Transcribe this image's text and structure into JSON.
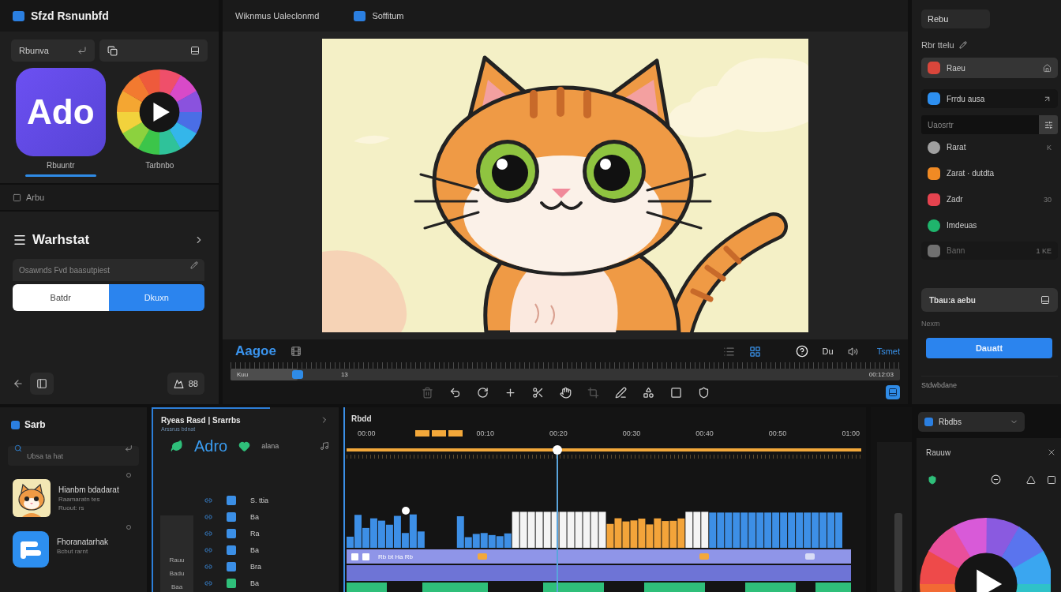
{
  "app_bar": {
    "title": "Sfzd Rsnunbfd"
  },
  "quick_buttons": [
    {
      "kind": "text",
      "label": "Rbunva"
    },
    {
      "kind": "icon"
    }
  ],
  "apps": [
    {
      "kind": "logo",
      "logo_text": "Ado",
      "label": "Rbuuntr",
      "selected": true
    },
    {
      "kind": "wheel",
      "label": "Tarbnbo",
      "selected": false
    }
  ],
  "section": {
    "label": "Arbu"
  },
  "workspace": {
    "title": "Warhstat",
    "field": {
      "placeholder": "Osawnds Fvd baasutpiest"
    },
    "segments": [
      {
        "label": "Batdr",
        "selected": false
      },
      {
        "label": "Dkuxn",
        "selected": true
      }
    ],
    "footer_button": "88"
  },
  "viewer": {
    "title": "Wiknmus Ualeclonmd",
    "tab": "Soffitum"
  },
  "player": {
    "title": "Aagoe",
    "speed": "Du",
    "mode": "Tsmet",
    "start": "Kuu",
    "mark": "13",
    "duration": "00:12:03",
    "level": 0.1
  },
  "inspector": {
    "tab": "Rebu",
    "heading": "Rbr ttelu",
    "pinned": [
      {
        "label": "Raeu",
        "color": "#d9463b",
        "selected": true
      },
      {
        "label": "Frrdu ausa",
        "color": "#2d8ff0",
        "selected": false
      }
    ],
    "field": {
      "placeholder": "Uaosrtr"
    },
    "items": [
      {
        "label": "Rarat",
        "color": "#a0a0a0",
        "meta": "K",
        "selected": false,
        "disabled": false
      },
      {
        "label": "Zarat · dutdta",
        "color": "#f08a24",
        "selected": false,
        "disabled": false
      },
      {
        "label": "Zadr",
        "color": "#e5434f",
        "meta": "30",
        "selected": false,
        "disabled": false
      },
      {
        "label": "Imdeuas",
        "color": "#1fb46c",
        "selected": false,
        "disabled": false
      },
      {
        "label": "Bann",
        "color": "#707070",
        "meta": "1 KE",
        "selected": false,
        "disabled": true
      }
    ],
    "section_button": "Tbau:a aebu",
    "note": "Nexm",
    "primary_button": "Dauatt",
    "footer": "Stdwbdane"
  },
  "media": {
    "title": "Sarb",
    "search": {
      "placeholder": "Ubsa ta hat"
    },
    "items": [
      {
        "kind": "cat",
        "title": "Hianbm bdadarat",
        "lines": [
          "Raamaratn tes",
          "Ruout: rs"
        ]
      },
      {
        "kind": "app",
        "title": "Fhoranatarhak",
        "lines": [
          "Bcbut rarnt"
        ]
      }
    ]
  },
  "tracks_panel": {
    "title": "Ryeas Rasd | Srarrbs",
    "subtitle": "Arssrus bdnat",
    "app_label": "Adro",
    "tag": "alana",
    "groups": [
      "Rauu",
      "Badu",
      "Baa"
    ],
    "tracks": [
      {
        "label": "S. ttia",
        "color": "#3b8fe6"
      },
      {
        "label": "Ba",
        "color": "#3b8fe6"
      },
      {
        "label": "Ra",
        "color": "#3b8fe6"
      },
      {
        "label": "Ba",
        "color": "#3b8fe6"
      },
      {
        "label": "Bra",
        "color": "#3b8fe6"
      },
      {
        "label": "Ba",
        "color": "#2fbf7a"
      }
    ]
  },
  "timeline": {
    "title": "Rbdd",
    "marks": [
      "00:00",
      "00:10",
      "00:20",
      "00:30",
      "00:40",
      "00:50",
      "01:00"
    ],
    "level": 0.41,
    "lanes": [
      {
        "kind": "waveform"
      },
      {
        "kind": "effects",
        "label": "Rb bt Ha Rb"
      },
      {
        "kind": "titles"
      },
      {
        "kind": "video"
      }
    ]
  },
  "output": {
    "dropdown": "Rbdbs",
    "title": "Rauuw"
  }
}
